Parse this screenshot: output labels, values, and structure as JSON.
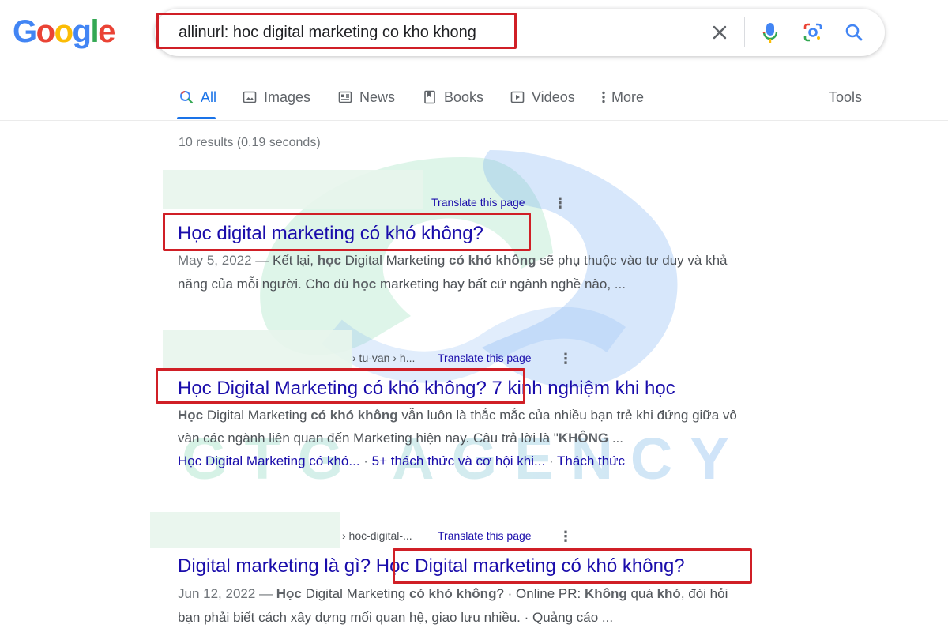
{
  "logo": {
    "letters": [
      "G",
      "o",
      "o",
      "g",
      "l",
      "e"
    ],
    "colors": [
      "#4285f4",
      "#ea4335",
      "#fbbc05",
      "#4285f4",
      "#34a853",
      "#ea4335"
    ]
  },
  "search": {
    "query": "allinurl: hoc digital marketing co kho khong"
  },
  "icons": {
    "clear": "close-icon",
    "voice": "microphone-icon",
    "lens": "lens-icon",
    "search": "search-icon"
  },
  "tabs": [
    {
      "label": "All",
      "icon": "search-icon"
    },
    {
      "label": "Images",
      "icon": "image-icon"
    },
    {
      "label": "News",
      "icon": "news-icon"
    },
    {
      "label": "Books",
      "icon": "book-icon"
    },
    {
      "label": "Videos",
      "icon": "video-icon"
    },
    {
      "label": "More",
      "icon": "more-vert-icon"
    }
  ],
  "tools_label": "Tools",
  "stats": "10 results (0.19 seconds)",
  "results": [
    {
      "breadcrumb": "",
      "translate": "Translate this page",
      "title": "Học digital marketing có khó không?",
      "title_extra": "",
      "snippet": [
        [
          {
            "t": "May 5, 2022 — ",
            "s": "date"
          },
          {
            "t": "Kết lại, "
          },
          {
            "t": "học",
            "b": true
          },
          {
            "t": " Digital Marketing "
          },
          {
            "t": "có khó không",
            "b": true
          },
          {
            "t": " sẽ phụ thuộc vào tư duy và khả"
          }
        ],
        [
          {
            "t": "năng của mỗi người. Cho dù "
          },
          {
            "t": "học",
            "b": true
          },
          {
            "t": " marketing hay bất cứ ngành nghề nào, ..."
          }
        ]
      ]
    },
    {
      "breadcrumb": "› tu-van › h...",
      "translate": "Translate this page",
      "title": "Học Digital Marketing có khó không?",
      "title_extra": " 7 kinh nghiệm khi học",
      "snippet": [
        [
          {
            "t": "Học",
            "b": true
          },
          {
            "t": " Digital Marketing "
          },
          {
            "t": "có khó không",
            "b": true
          },
          {
            "t": " vẫn luôn là thắc mắc của nhiều bạn trẻ khi đứng giữa vô"
          }
        ],
        [
          {
            "t": "vàn các ngành liên quan đến Marketing hiện nay. Câu trả lời là \""
          },
          {
            "t": "KHÔNG",
            "b": true
          },
          {
            "t": " ..."
          }
        ]
      ],
      "sitelinks": [
        "Học Digital Marketing có khó...",
        "5+ thách thức và cơ hội khi...",
        "Thách thức"
      ]
    },
    {
      "breadcrumb": "› hoc-digital-...",
      "translate": "Translate this page",
      "title_prefix": "Digital marketing là gì? ",
      "title": "Học Digital marketing có khó không?",
      "snippet": [
        [
          {
            "t": "Jun 12, 2022 — ",
            "s": "date"
          },
          {
            "t": "Học",
            "b": true
          },
          {
            "t": " Digital Marketing "
          },
          {
            "t": "có khó không",
            "b": true
          },
          {
            "t": "? · Online PR: "
          },
          {
            "t": "Không",
            "b": true
          },
          {
            "t": " quá "
          },
          {
            "t": "khó",
            "b": true
          },
          {
            "t": ", đòi hỏi"
          }
        ],
        [
          {
            "t": "bạn phải biết cách xây dựng mối quan hệ, giao lưu nhiều. · Quảng cáo ..."
          }
        ]
      ]
    }
  ],
  "watermark_text": "GTG AGENCY",
  "colors": {
    "link": "#1a0dab",
    "highlight": "#d01f26",
    "accent": "#1a73e8"
  }
}
